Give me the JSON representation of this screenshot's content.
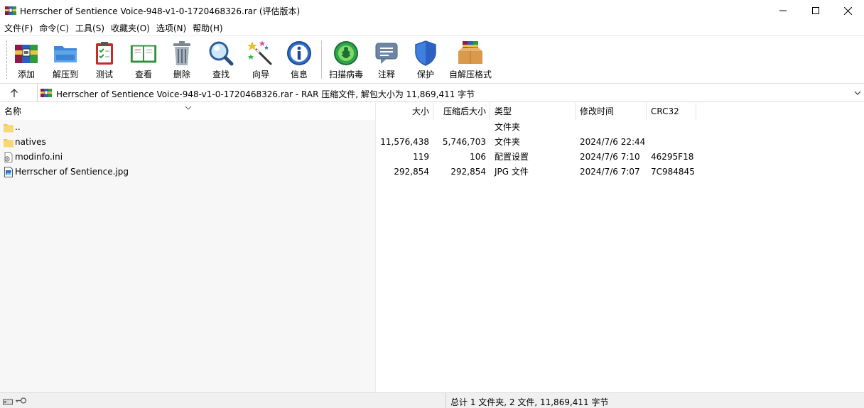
{
  "window": {
    "title": "Herrscher of Sentience Voice-948-v1-0-1720468326.rar (评估版本)"
  },
  "menu": [
    "文件(F)",
    "命令(C)",
    "工具(S)",
    "收藏夹(O)",
    "选项(N)",
    "帮助(H)"
  ],
  "toolbar": {
    "buttons": [
      {
        "label": "添加",
        "icon": "add-archive-icon"
      },
      {
        "label": "解压到",
        "icon": "extract-to-icon"
      },
      {
        "label": "测试",
        "icon": "test-icon"
      },
      {
        "label": "查看",
        "icon": "view-book-icon"
      },
      {
        "label": "删除",
        "icon": "trash-icon"
      },
      {
        "label": "查找",
        "icon": "magnifier-icon"
      },
      {
        "label": "向导",
        "icon": "wizard-wand-icon"
      },
      {
        "label": "信息",
        "icon": "info-icon"
      },
      {
        "label": "扫描病毒",
        "icon": "virus-scan-icon"
      },
      {
        "label": "注释",
        "icon": "comment-icon"
      },
      {
        "label": "保护",
        "icon": "shield-icon"
      },
      {
        "label": "自解压格式",
        "icon": "sfx-box-icon"
      }
    ]
  },
  "address": {
    "path": "Herrscher of Sentience Voice-948-v1-0-1720468326.rar - RAR 压缩文件, 解包大小为 11,869,411 字节"
  },
  "columns": {
    "name": "名称",
    "size": "大小",
    "packed": "压缩后大小",
    "type": "类型",
    "modified": "修改时间",
    "crc": "CRC32"
  },
  "files": [
    {
      "name": "..",
      "size": "",
      "packed": "",
      "type": "文件夹",
      "modified": "",
      "crc": "",
      "icon": "folder-icon"
    },
    {
      "name": "natives",
      "size": "11,576,438",
      "packed": "5,746,703",
      "type": "文件夹",
      "modified": "2024/7/6 22:44",
      "crc": "",
      "icon": "folder-icon"
    },
    {
      "name": "modinfo.ini",
      "size": "119",
      "packed": "106",
      "type": "配置设置",
      "modified": "2024/7/6 7:10",
      "crc": "46295F18",
      "icon": "ini-file-icon"
    },
    {
      "name": "Herrscher of Sentience.jpg",
      "size": "292,854",
      "packed": "292,854",
      "type": "JPG 文件",
      "modified": "2024/7/6 7:07",
      "crc": "7C984845",
      "icon": "image-file-icon"
    }
  ],
  "status": {
    "summary": "总计 1 文件夹, 2 文件, 11,869,411 字节"
  }
}
